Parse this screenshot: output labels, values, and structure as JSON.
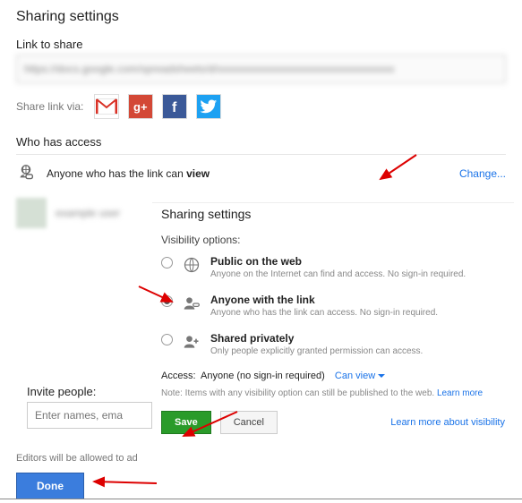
{
  "title": "Sharing settings",
  "link_section": {
    "label": "Link to share",
    "value": "https://docs.google.com/spreadsheets/d/xxxxxxxxxxxxxxxxxxxxxxxxxxxxxxxxx"
  },
  "share_via": {
    "label": "Share link via:"
  },
  "who_has_access": {
    "label": "Who has access",
    "row_prefix": "Anyone who has the link can ",
    "row_bold": "view",
    "change_label": "Change...",
    "user_name": "example user"
  },
  "overlay": {
    "title": "Sharing settings",
    "vis_label": "Visibility options:",
    "options": [
      {
        "title": "Public on the web",
        "desc": "Anyone on the Internet can find and access. No sign-in required.",
        "selected": false
      },
      {
        "title": "Anyone with the link",
        "desc": "Anyone who has the link can access. No sign-in required.",
        "selected": true
      },
      {
        "title": "Shared privately",
        "desc": "Only people explicitly granted permission can access.",
        "selected": false
      }
    ],
    "access_label": "Access:",
    "access_value": "Anyone (no sign-in required)",
    "can_view": "Can view",
    "note_prefix": "Note: Items with any visibility option can still be published to the web. ",
    "note_link": "Learn more",
    "save": "Save",
    "cancel": "Cancel",
    "learn_more": "Learn more about visibility"
  },
  "invite": {
    "label": "Invite people:",
    "placeholder": "Enter names, ema"
  },
  "footer": {
    "editors_note": "Editors will be allowed to ad",
    "done": "Done"
  }
}
